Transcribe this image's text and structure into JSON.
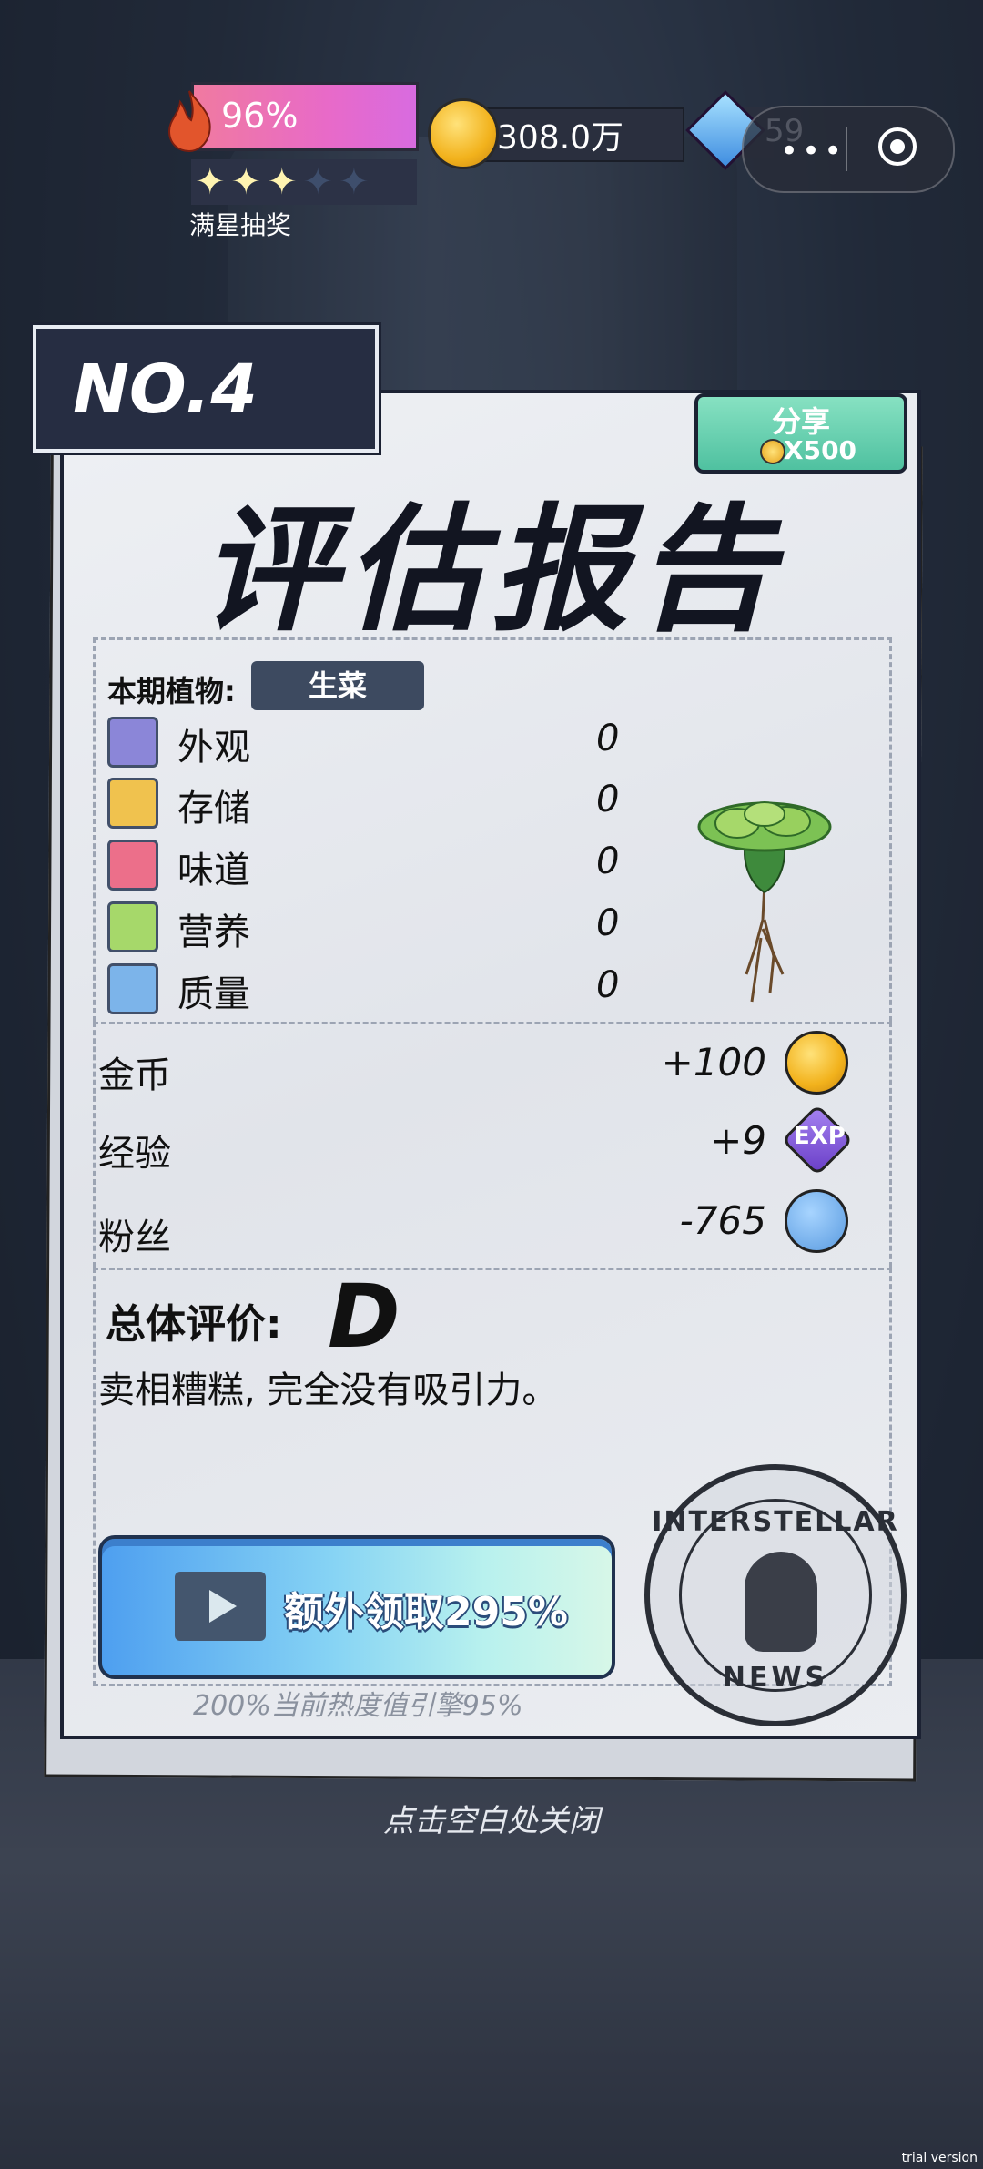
{
  "hud": {
    "heat_percent": "96%",
    "stars_filled": 3,
    "stars_total": 5,
    "star_lottery": "满星抽奖",
    "coins": "308.0万",
    "gems": "59"
  },
  "report": {
    "number": "NO.4",
    "share_label": "分享",
    "share_cost": "X500",
    "title": "评估报告",
    "plant_label": "本期植物:",
    "plant_name": "生菜",
    "stats": [
      {
        "name": "外观",
        "value": "0",
        "icon": "sparkle-icon",
        "color": "#8b86d8"
      },
      {
        "name": "存储",
        "value": "0",
        "icon": "box-icon",
        "color": "#f0c24e"
      },
      {
        "name": "味道",
        "value": "0",
        "icon": "utensils-icon",
        "color": "#ec6f8a"
      },
      {
        "name": "营养",
        "value": "0",
        "icon": "fruit-icon",
        "color": "#a6d86a"
      },
      {
        "name": "质量",
        "value": "0",
        "icon": "muscle-icon",
        "color": "#7cb4ea"
      }
    ],
    "rewards": [
      {
        "name": "金币",
        "value": "+100",
        "icon": "coin-icon"
      },
      {
        "name": "经验",
        "value": "+9",
        "icon": "exp-icon",
        "icon_text": "EXP"
      },
      {
        "name": "粉丝",
        "value": "-765",
        "icon": "fans-icon"
      }
    ],
    "overall_label": "总体评价:",
    "grade": "D",
    "comment": "卖相糟糕, 完全没有吸引力。",
    "extra_button": "额外领取295%",
    "extra_note": "200%当前热度值引擎95%",
    "stamp_top": "INTERSTELLAR",
    "stamp_bottom": "NEWS"
  },
  "close_hint": "点击空白处关闭",
  "watermark": "trial version"
}
